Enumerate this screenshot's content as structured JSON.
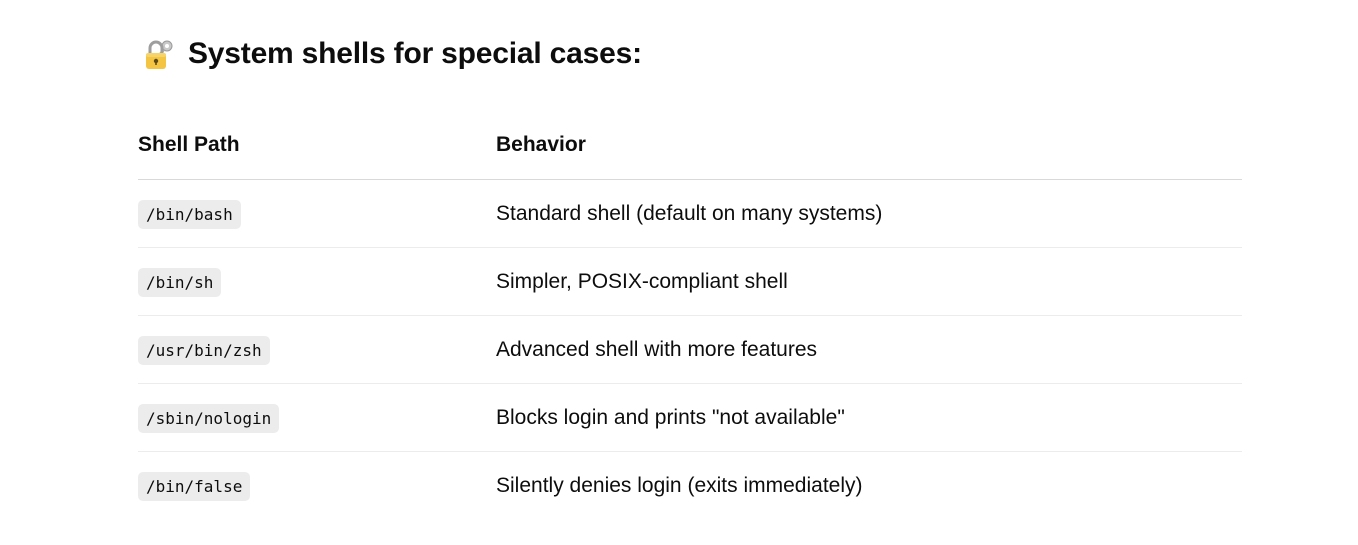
{
  "heading": {
    "icon": "lock-with-key-icon",
    "title": "System shells for special cases:"
  },
  "table": {
    "headers": [
      "Shell Path",
      "Behavior"
    ],
    "rows": [
      {
        "path": "/bin/bash",
        "behavior": "Standard shell (default on many systems)"
      },
      {
        "path": "/bin/sh",
        "behavior": "Simpler, POSIX-compliant shell"
      },
      {
        "path": "/usr/bin/zsh",
        "behavior": "Advanced shell with more features"
      },
      {
        "path": "/sbin/nologin",
        "behavior": "Blocks login and prints \"not available\""
      },
      {
        "path": "/bin/false",
        "behavior": "Silently denies login (exits immediately)"
      }
    ]
  },
  "colors": {
    "text": "#0d0d0d",
    "code_background": "#ececec",
    "lock_body": "#f4c542",
    "key": "#b8b8b8"
  }
}
